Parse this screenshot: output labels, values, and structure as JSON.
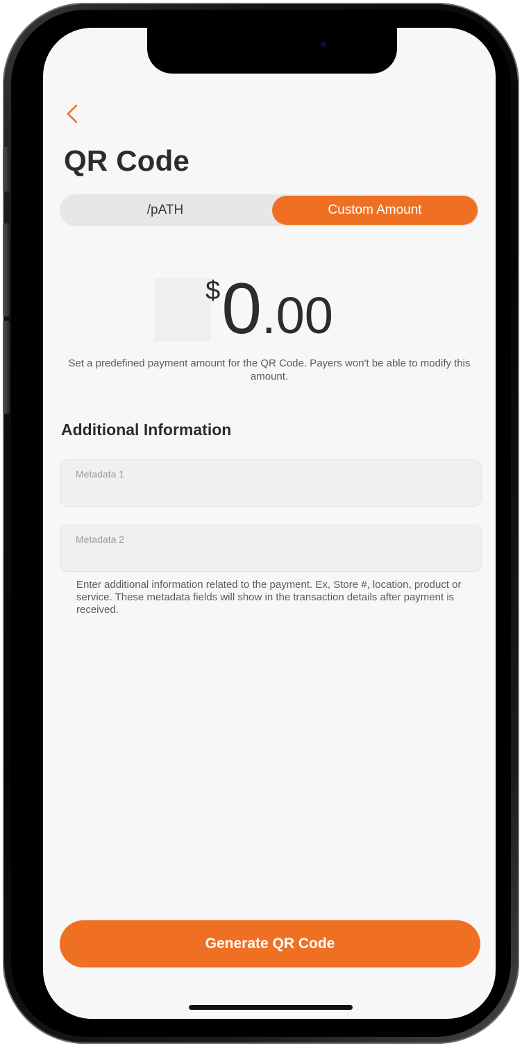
{
  "nav": {
    "back_icon": "chevron-left-icon"
  },
  "header": {
    "title": "QR Code"
  },
  "segmented": {
    "options": [
      {
        "label": "/pATH",
        "selected": false
      },
      {
        "label": "Custom Amount",
        "selected": true
      }
    ]
  },
  "amount": {
    "currency": "$",
    "whole": "0",
    "decimal": ".00",
    "hint": "Set a predefined payment amount for the QR Code. Payers won't be able to modify this amount."
  },
  "additional_info": {
    "heading": "Additional Information",
    "fields": [
      {
        "placeholder": "Metadata 1",
        "value": ""
      },
      {
        "placeholder": "Metadata 2",
        "value": ""
      }
    ],
    "note": "Enter additional information related to the payment. Ex, Store #, location, product or service. These metadata fields will show in the transaction details after payment is received."
  },
  "actions": {
    "generate_label": "Generate QR Code"
  },
  "colors": {
    "accent": "#f07023",
    "background": "#f7f7f7",
    "text": "#2c2c2e"
  }
}
